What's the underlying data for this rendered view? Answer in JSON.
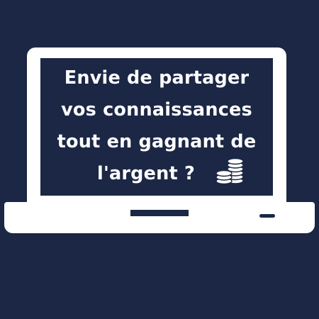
{
  "colors": {
    "background": "#1b2744",
    "laptop_body": "#ffffff",
    "screen": "#1b2744",
    "text": "#ffffff"
  },
  "message": {
    "lines": [
      "Envie de partager",
      "vos connaissances",
      "tout en gagnant de",
      "l'argent ?"
    ]
  },
  "icons": {
    "coins": "coin-stack-icon"
  }
}
